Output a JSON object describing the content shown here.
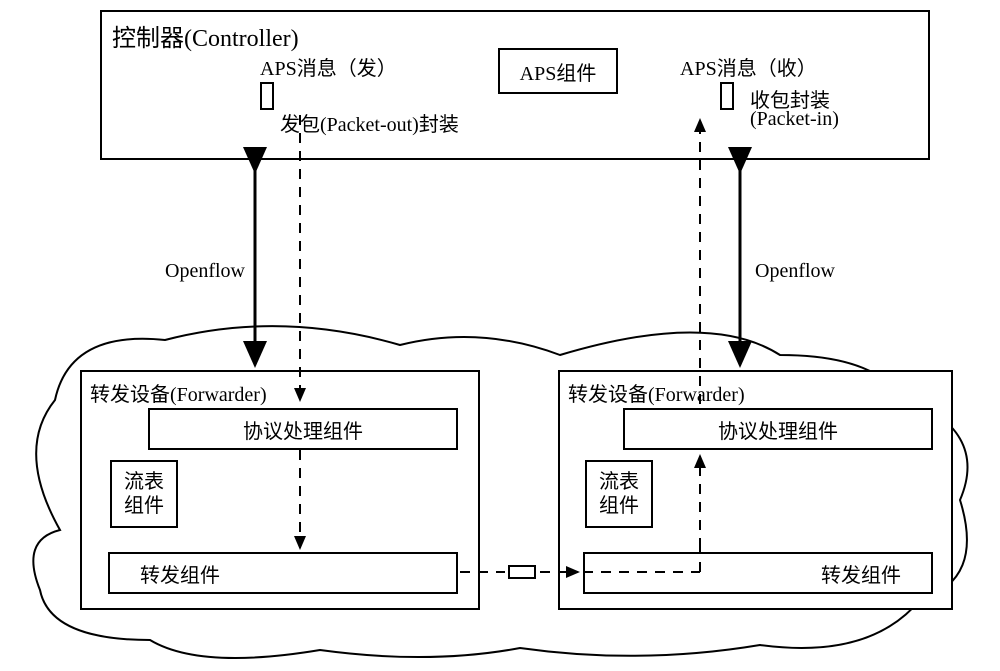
{
  "controller": {
    "title": "控制器(Controller)",
    "aps_send": "APS消息（发）",
    "packet_out": "发包(Packet-out)封装",
    "aps_component": "APS组件",
    "aps_recv": "APS消息（收）",
    "packet_in_1": "收包封装",
    "packet_in_2": "(Packet-in)"
  },
  "link": {
    "proto": "Openflow"
  },
  "forwarder_left": {
    "title": "转发设备(Forwarder)",
    "protocol_handler": "协议处理组件",
    "flow_table_1": "流表",
    "flow_table_2": "组件",
    "forward_component": "转发组件"
  },
  "forwarder_right": {
    "title": "转发设备(Forwarder)",
    "protocol_handler": "协议处理组件",
    "flow_table_1": "流表",
    "flow_table_2": "组件",
    "forward_component": "转发组件"
  }
}
